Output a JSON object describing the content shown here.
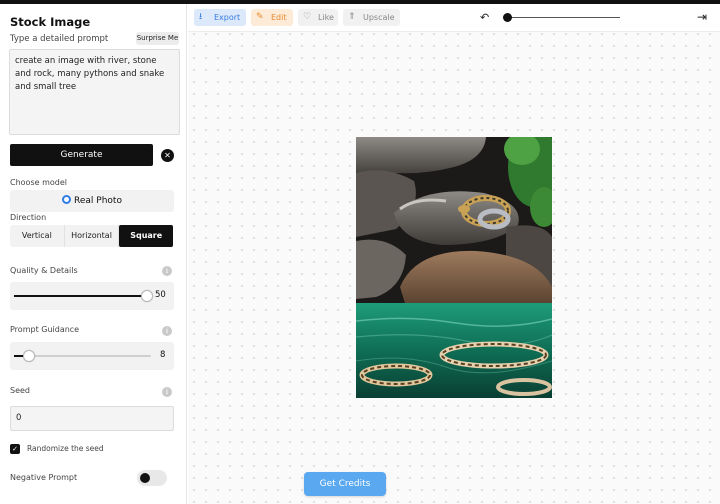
{
  "sidebar": {
    "title": "Stock Image",
    "prompt_label": "Type a detailed prompt",
    "surprise_label": "Surprise Me",
    "prompt_text": "create an image with river, stone and rock, many pythons and snake and small tree",
    "generate_label": "Generate",
    "model_label": "Choose model",
    "model_value": "Real Photo",
    "direction_label": "Direction",
    "directions": [
      "Vertical",
      "Horizontal",
      "Square"
    ],
    "direction_selected": "Square",
    "quality_label": "Quality & Details",
    "quality_value": "50",
    "quality_fraction": 0.98,
    "guidance_label": "Prompt Guidance",
    "guidance_value": "8",
    "guidance_fraction": 0.11,
    "seed_label": "Seed",
    "seed_value": "0",
    "randomize_label": "Randomize the seed",
    "randomize_checked": true,
    "negative_label": "Negative Prompt",
    "negative_enabled": false
  },
  "toolbar": {
    "export_label": "Export",
    "edit_label": "Edit",
    "like_label": "Like",
    "upscale_label": "Upscale",
    "export_icon": "download-icon",
    "edit_icon": "pencil-icon",
    "like_icon": "heart-icon",
    "upscale_icon": "upscale-icon",
    "zoom_fraction": 0.03
  },
  "main": {
    "credits_label": "Get Credits"
  },
  "colors": {
    "accent_blue": "#3a7be0",
    "edit_orange": "#e58a2e",
    "credits_blue": "#5aa8ef",
    "primary_black": "#111111"
  }
}
